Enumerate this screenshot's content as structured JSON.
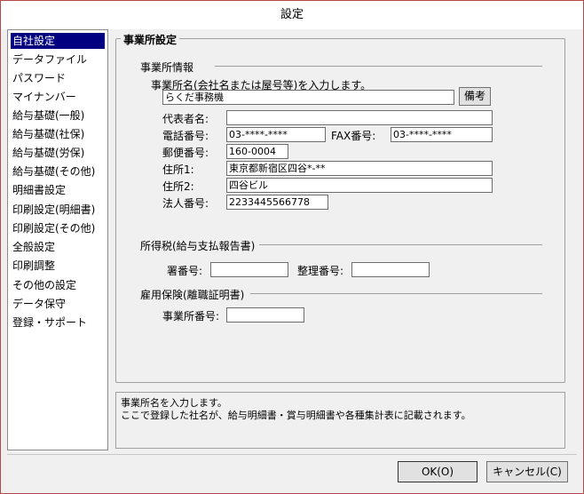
{
  "window": {
    "title": "設定"
  },
  "sidebar": {
    "items": [
      {
        "label": "自社設定",
        "selected": true
      },
      {
        "label": "データファイル"
      },
      {
        "label": "パスワード"
      },
      {
        "label": "マイナンバー"
      },
      {
        "label": "給与基礎(一般)"
      },
      {
        "label": "給与基礎(社保)"
      },
      {
        "label": "給与基礎(労保)"
      },
      {
        "label": "給与基礎(その他)"
      },
      {
        "label": "明細書設定"
      },
      {
        "label": "印刷設定(明細書)"
      },
      {
        "label": "印刷設定(その他)"
      },
      {
        "label": "全般設定"
      },
      {
        "label": "印刷調整"
      },
      {
        "label": "その他の設定"
      },
      {
        "label": "データ保守"
      },
      {
        "label": "登録・サポート"
      }
    ]
  },
  "panel": {
    "title": "事業所設定",
    "office_info": {
      "heading": "事業所情報",
      "name_prompt": "事業所名(会社名または屋号等)を入力します。",
      "name_value": "らくだ事務機",
      "remarks_button": "備考",
      "rep_label": "代表者名:",
      "rep_value": "",
      "phone_label": "電話番号:",
      "phone_value": "03-****-****",
      "fax_label": "FAX番号:",
      "fax_value": "03-****-****",
      "postal_label": "郵便番号:",
      "postal_value": "160-0004",
      "address1_label": "住所1:",
      "address1_value": "東京都新宿区四谷*-**",
      "address2_label": "住所2:",
      "address2_value": "四谷ビル",
      "corp_label": "法人番号:",
      "corp_value": "2233445566778"
    },
    "income_tax": {
      "heading": "所得税(給与支払報告書)",
      "office_no_label": "署番号:",
      "office_no_value": "",
      "ref_no_label": "整理番号:",
      "ref_no_value": ""
    },
    "employment": {
      "heading": "雇用保険(離職証明書)",
      "biz_no_label": "事業所番号:",
      "biz_no_value": ""
    }
  },
  "help": {
    "line1": "事業所名を入力します。",
    "line2": "ここで登録した社名が、給与明細書・賞与明細書や各種集計表に記載されます。"
  },
  "buttons": {
    "ok": "OK(O)",
    "cancel": "キャンセル(C)"
  }
}
